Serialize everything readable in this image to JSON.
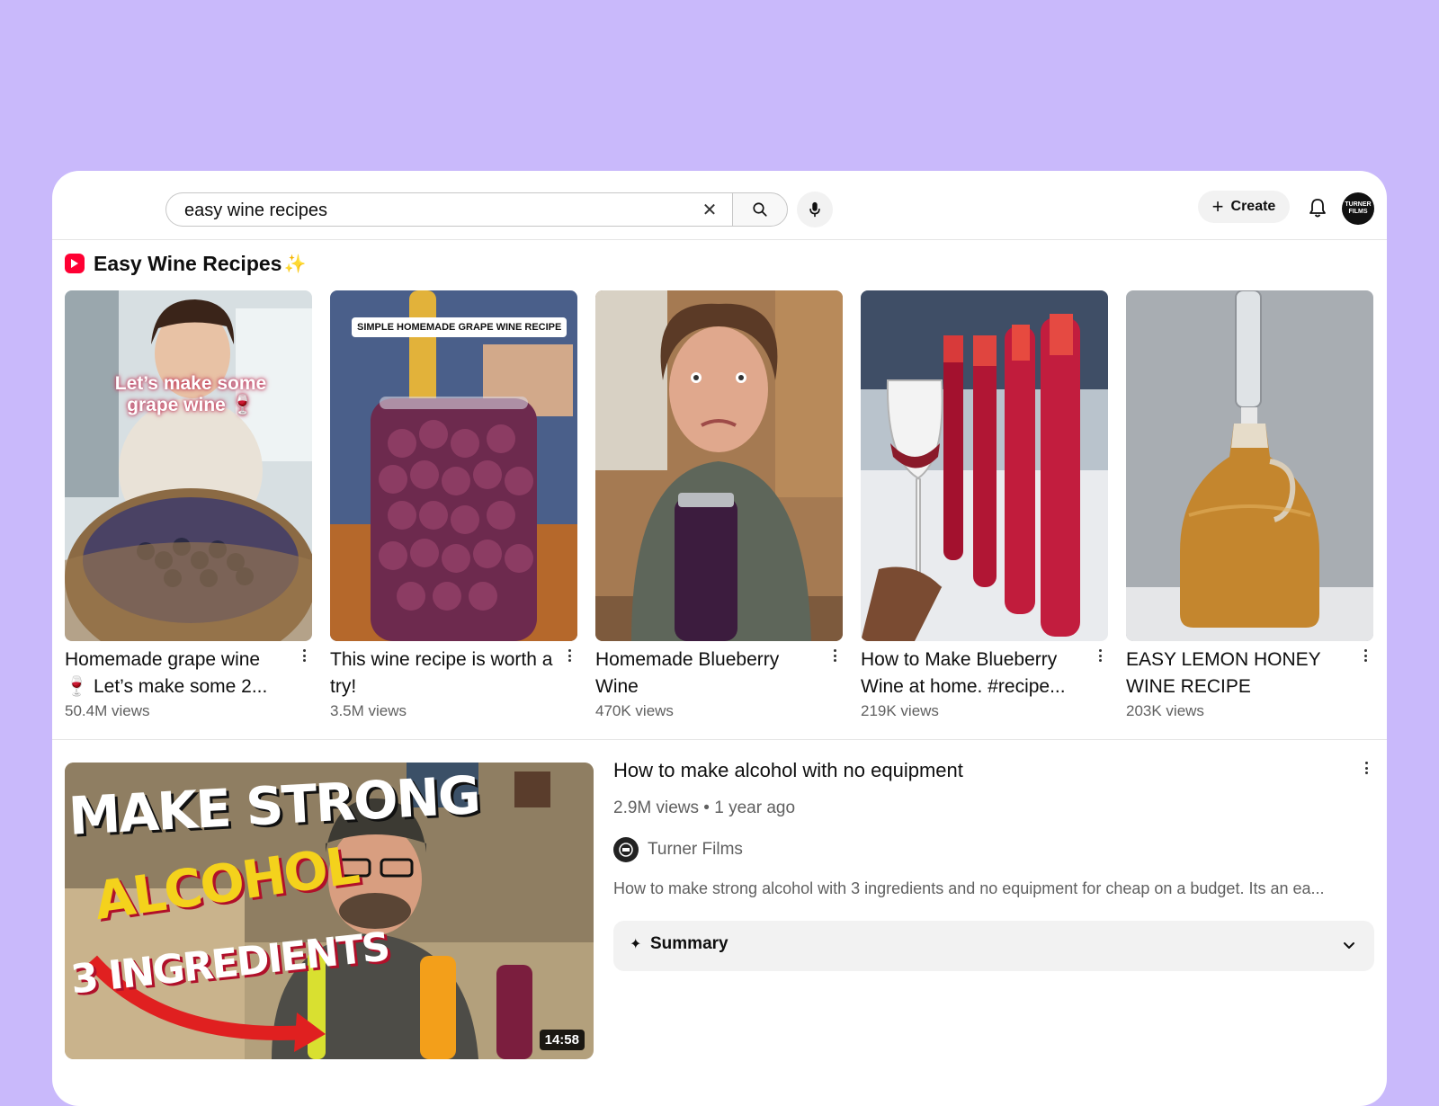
{
  "search": {
    "query": "easy wine recipes"
  },
  "header": {
    "create_label": "Create"
  },
  "shelf": {
    "title": "Easy Wine Recipes",
    "shorts": [
      {
        "title": "Homemade grape wine 🍷 Let’s make some 2...",
        "views": "50.4M views",
        "overlay": "Let’s make some grape wine 🍷"
      },
      {
        "title": "This wine recipe is worth a try!",
        "views": "3.5M views",
        "overlay": "SIMPLE HOMEMADE GRAPE WINE RECIPE"
      },
      {
        "title": "Homemade Blueberry Wine",
        "views": "470K views",
        "overlay": ""
      },
      {
        "title": "How to Make Blueberry Wine at home. #recipe...",
        "views": "219K views",
        "overlay": ""
      },
      {
        "title": "EASY LEMON HONEY WINE RECIPE",
        "views": "203K views",
        "overlay": ""
      }
    ]
  },
  "video": {
    "title": "How to make alcohol with no equipment",
    "meta": "2.9M views • 1 year ago",
    "channel": "Turner Films",
    "description": "How to make strong alcohol with 3 ingredients and no equipment for cheap on a budget. Its an ea...",
    "duration": "14:58",
    "thumb_line1": "MAKE STRONG",
    "thumb_line2": "ALCOHOL",
    "thumb_line3": "3 INGREDIENTS",
    "summary_label": "Summary"
  },
  "avatar_text": "TURNER FILMS",
  "colors": {
    "background": "#c9b9fb",
    "brand_red": "#ff0033",
    "secondary_text": "#606060"
  }
}
